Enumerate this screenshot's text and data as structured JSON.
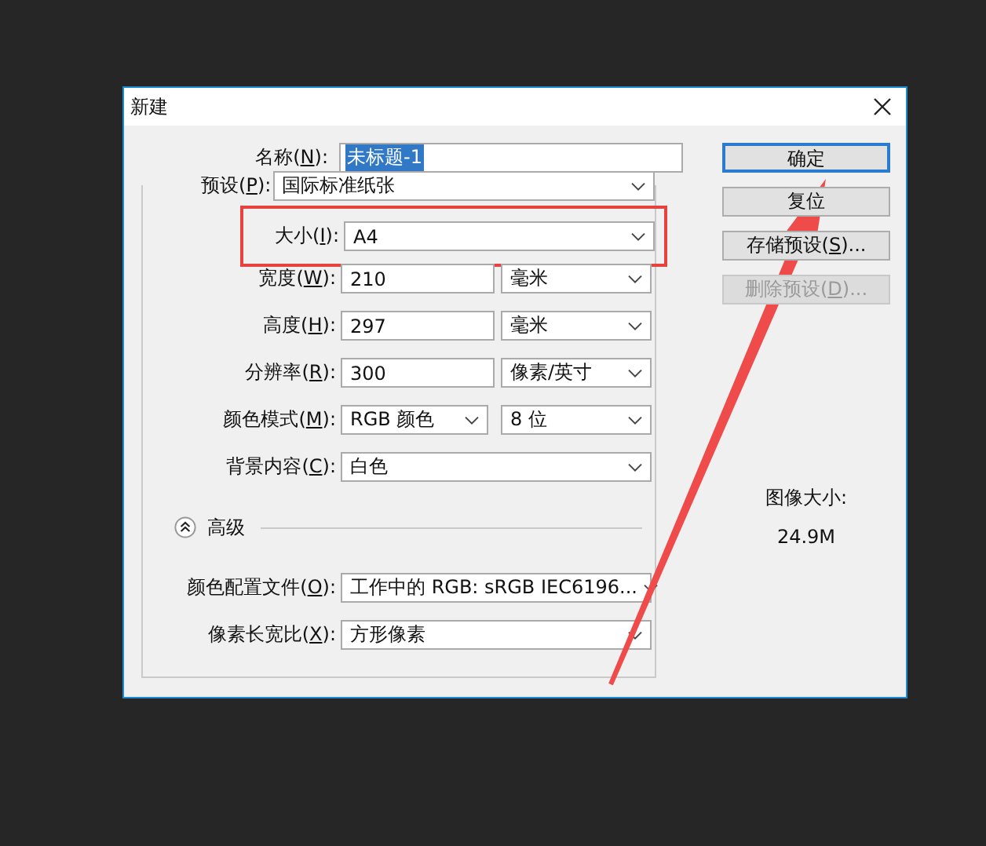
{
  "window": {
    "title": "新建"
  },
  "name_field": {
    "label": [
      "名称(",
      "N",
      "):"
    ],
    "value": "未标题-1",
    "selected": true
  },
  "preset": {
    "label": [
      "预设(",
      "P",
      "):"
    ],
    "value": "国际标准纸张"
  },
  "rows": [
    {
      "label": [
        "大小(",
        "I",
        "):"
      ],
      "highlighted": true,
      "controls": [
        {
          "kind": "select",
          "value": "A4"
        }
      ]
    },
    {
      "label": [
        "宽度(",
        "W",
        "):"
      ],
      "highlighted": false,
      "controls": [
        {
          "kind": "input",
          "value": "210"
        },
        {
          "kind": "select",
          "value": "毫米"
        }
      ]
    },
    {
      "label": [
        "高度(",
        "H",
        "):"
      ],
      "highlighted": false,
      "controls": [
        {
          "kind": "input",
          "value": "297"
        },
        {
          "kind": "select",
          "value": "毫米"
        }
      ]
    },
    {
      "label": [
        "分辨率(",
        "R",
        "):"
      ],
      "highlighted": false,
      "controls": [
        {
          "kind": "input",
          "value": "300"
        },
        {
          "kind": "select",
          "value": "像素/英寸"
        }
      ]
    },
    {
      "label": [
        "颜色模式(",
        "M",
        "):"
      ],
      "highlighted": false,
      "controls": [
        {
          "kind": "select",
          "value": "RGB 颜色"
        },
        {
          "kind": "select",
          "value": "8 位"
        }
      ]
    },
    {
      "label": [
        "背景内容(",
        "C",
        "):"
      ],
      "highlighted": false,
      "controls": [
        {
          "kind": "select",
          "value": "白色"
        }
      ]
    }
  ],
  "advanced": {
    "label": "高级",
    "expanded": true
  },
  "advanced_rows": [
    {
      "label": [
        "颜色配置文件(",
        "O",
        "):"
      ],
      "highlighted": false,
      "controls": [
        {
          "kind": "select",
          "value": "工作中的 RGB: sRGB IEC6196..."
        }
      ]
    },
    {
      "label": [
        "像素长宽比(",
        "X",
        "):"
      ],
      "highlighted": false,
      "controls": [
        {
          "kind": "select",
          "value": "方形像素"
        }
      ]
    }
  ],
  "buttons": [
    {
      "label": [
        "确定"
      ],
      "default": true,
      "disabled": false
    },
    {
      "label": [
        "复位"
      ],
      "default": false,
      "disabled": false
    },
    {
      "label": [
        "存储预设(",
        "S",
        ")..."
      ],
      "default": false,
      "disabled": false
    },
    {
      "label": [
        "删除预设(",
        "D",
        ")..."
      ],
      "default": false,
      "disabled": true
    }
  ],
  "annotation": {
    "kind": "arrow"
  },
  "image_size": {
    "label": "图像大小:",
    "value": "24.9M"
  }
}
